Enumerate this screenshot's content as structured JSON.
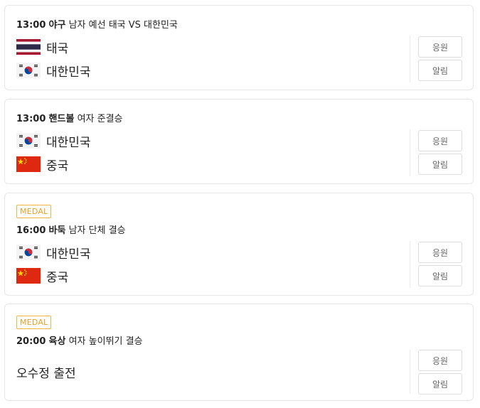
{
  "matches": [
    {
      "time": "13:00",
      "sport": "야구",
      "event": "남자 예선 태국 VS 대한민국",
      "teams": [
        {
          "name": "태국",
          "flag": "thailand-flag-icon"
        },
        {
          "name": "대한민국",
          "flag": "korea-flag-icon"
        }
      ],
      "cheer_label": "응원",
      "alarm_label": "알림"
    },
    {
      "time": "13:00",
      "sport": "핸드볼",
      "event": "여자 준결승",
      "teams": [
        {
          "name": "대한민국",
          "flag": "korea-flag-icon"
        },
        {
          "name": "중국",
          "flag": "china-flag-icon"
        }
      ],
      "cheer_label": "응원",
      "alarm_label": "알림"
    },
    {
      "badge": "MEDAL",
      "time": "16:00",
      "sport": "바둑",
      "event": "남자 단체 결승",
      "teams": [
        {
          "name": "대한민국",
          "flag": "korea-flag-icon"
        },
        {
          "name": "중국",
          "flag": "china-flag-icon"
        }
      ],
      "cheer_label": "응원",
      "alarm_label": "알림"
    },
    {
      "badge": "MEDAL",
      "time": "20:00",
      "sport": "육상",
      "event": "여자 높이뛰기 결승",
      "participant": "오수정 출전",
      "cheer_label": "응원",
      "alarm_label": "알림"
    }
  ],
  "colors": {
    "medal": "#f3b53f",
    "border": "#e6e6e6",
    "button_text": "#666666"
  }
}
